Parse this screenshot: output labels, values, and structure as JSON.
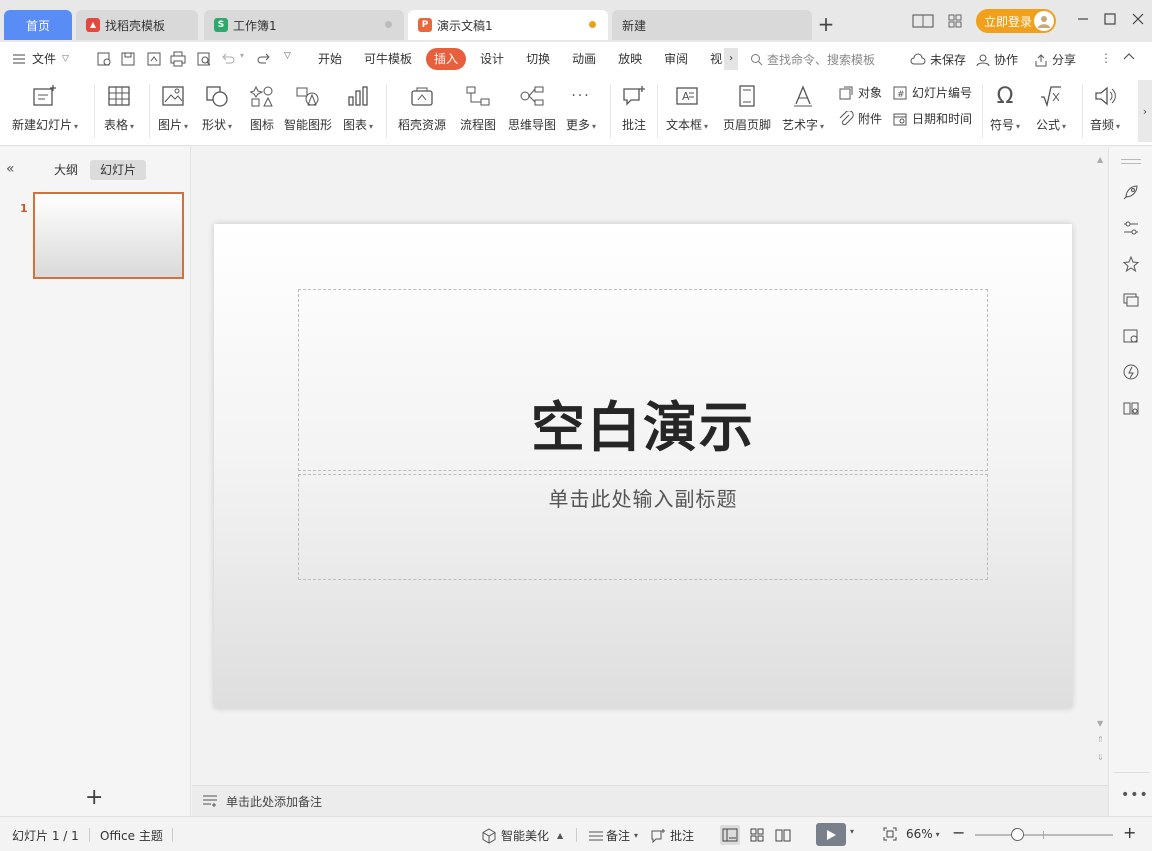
{
  "tabs": {
    "home": "首页",
    "items": [
      {
        "label": "找稻壳模板",
        "icon": "docer-icon",
        "color": "#e2483d"
      },
      {
        "label": "工作簿1",
        "icon": "spreadsheet-icon",
        "color": "#2fa86d",
        "glyph": "S"
      },
      {
        "label": "演示文稿1",
        "icon": "presentation-icon",
        "color": "#e5683f",
        "glyph": "P"
      },
      {
        "label": "新建"
      }
    ],
    "new_tab": "+",
    "login": "立即登录"
  },
  "menubar": {
    "file": "文件",
    "tabs": [
      "开始",
      "可牛模板",
      "插入",
      "设计",
      "切换",
      "动画",
      "放映",
      "审阅",
      "视"
    ],
    "active_tab": "插入",
    "search_placeholder": "查找命令、搜索模板",
    "unsaved": "未保存",
    "collaborate": "协作",
    "share": "分享"
  },
  "ribbon": {
    "new_slide": "新建幻灯片",
    "table": "表格",
    "picture": "图片",
    "shape": "形状",
    "icon": "图标",
    "smart_graphic": "智能图形",
    "chart": "图表",
    "docer_resources": "稻壳资源",
    "flowchart": "流程图",
    "mindmap": "思维导图",
    "more": "更多",
    "comment": "批注",
    "textbox": "文本框",
    "header_footer": "页眉页脚",
    "wordart": "艺术字",
    "object": "对象",
    "attachment": "附件",
    "slide_number": "幻灯片编号",
    "datetime": "日期和时间",
    "symbol": "符号",
    "formula": "公式",
    "audio": "音频"
  },
  "leftpanel": {
    "tab_outline": "大纲",
    "tab_slides": "幻灯片",
    "slide_number": "1",
    "add": "+"
  },
  "slide": {
    "title": "空白演示",
    "subtitle": "单击此处输入副标题"
  },
  "notes": {
    "placeholder": "单击此处添加备注"
  },
  "statusbar": {
    "slide_count": "幻灯片 1 / 1",
    "theme": "Office 主题",
    "beautify": "智能美化",
    "notes": "备注",
    "comments": "批注",
    "zoom": "66%",
    "zoom_level": 0.5
  }
}
